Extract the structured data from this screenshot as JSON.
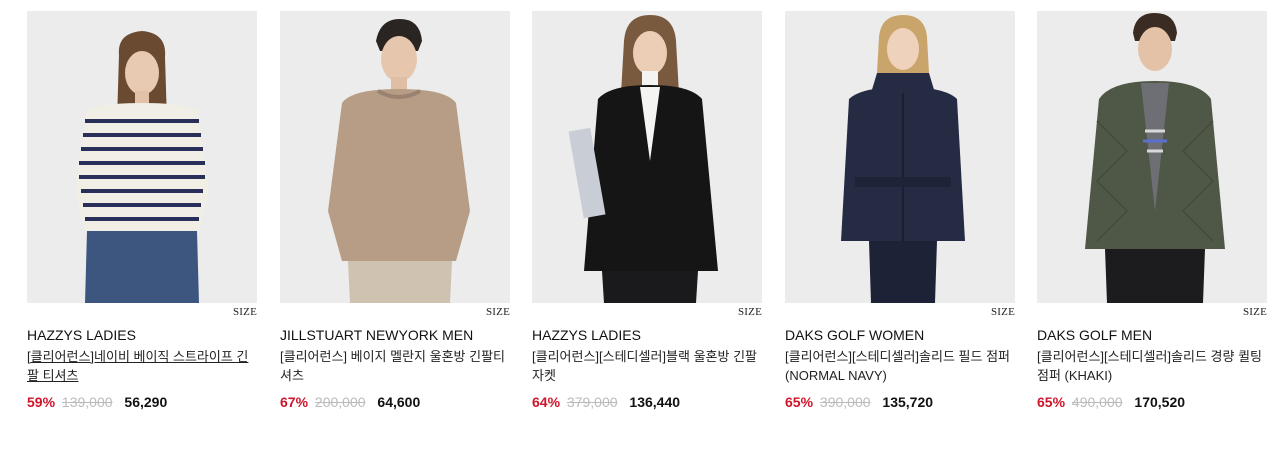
{
  "products": [
    {
      "size_label": "SIZE",
      "brand": "HAZZYS LADIES",
      "name": "[클리어런스]네이비 베이직 스트라이프 긴팔 티셔츠",
      "discount": "59%",
      "original_price": "139,000",
      "sale_price": "56,290",
      "image_icon": "model-striped-tee-photo",
      "colors": {
        "top": "#f1eee6",
        "stripe": "#2a2f5a",
        "bottom": "#3c5680",
        "hair": "#6b4a32"
      }
    },
    {
      "size_label": "SIZE",
      "brand": "JILLSTUART NEWYORK MEN",
      "name": "[클리어런스] 베이지 멜란지 울혼방 긴팔티셔츠",
      "discount": "67%",
      "original_price": "200,000",
      "sale_price": "64,600",
      "image_icon": "model-beige-knit-photo",
      "colors": {
        "top": "#b79d86",
        "bottom": "#cfc2b1",
        "hair": "#2a2522"
      }
    },
    {
      "size_label": "SIZE",
      "brand": "HAZZYS LADIES",
      "name": "[클리어런스][스테디셀러]블랙 울혼방 긴팔자켓",
      "discount": "64%",
      "original_price": "379,000",
      "sale_price": "136,440",
      "image_icon": "model-black-jacket-photo",
      "colors": {
        "top": "#151516",
        "inner": "#f4f4f2",
        "bottom": "#1a1a1c",
        "hair": "#7a5a3e"
      }
    },
    {
      "size_label": "SIZE",
      "brand": "DAKS GOLF WOMEN",
      "name": "[클리어런스][스테디셀러]솔리드 필드 점퍼 (NORMAL NAVY)",
      "discount": "65%",
      "original_price": "390,000",
      "sale_price": "135,720",
      "image_icon": "model-navy-field-jacket-photo",
      "colors": {
        "top": "#262b44",
        "bottom": "#1e2236",
        "hair": "#c9a56c"
      }
    },
    {
      "size_label": "SIZE",
      "brand": "DAKS GOLF MEN",
      "name": "[클리어런스][스테디셀러]솔리드 경량 퀼팅 점퍼 (KHAKI)",
      "discount": "65%",
      "original_price": "490,000",
      "sale_price": "170,520",
      "image_icon": "model-khaki-quilted-jumper-photo",
      "colors": {
        "top": "#4f5847",
        "inner": "#6d6f74",
        "bottom": "#1c1c1e",
        "hair": "#3a2c22"
      }
    }
  ]
}
